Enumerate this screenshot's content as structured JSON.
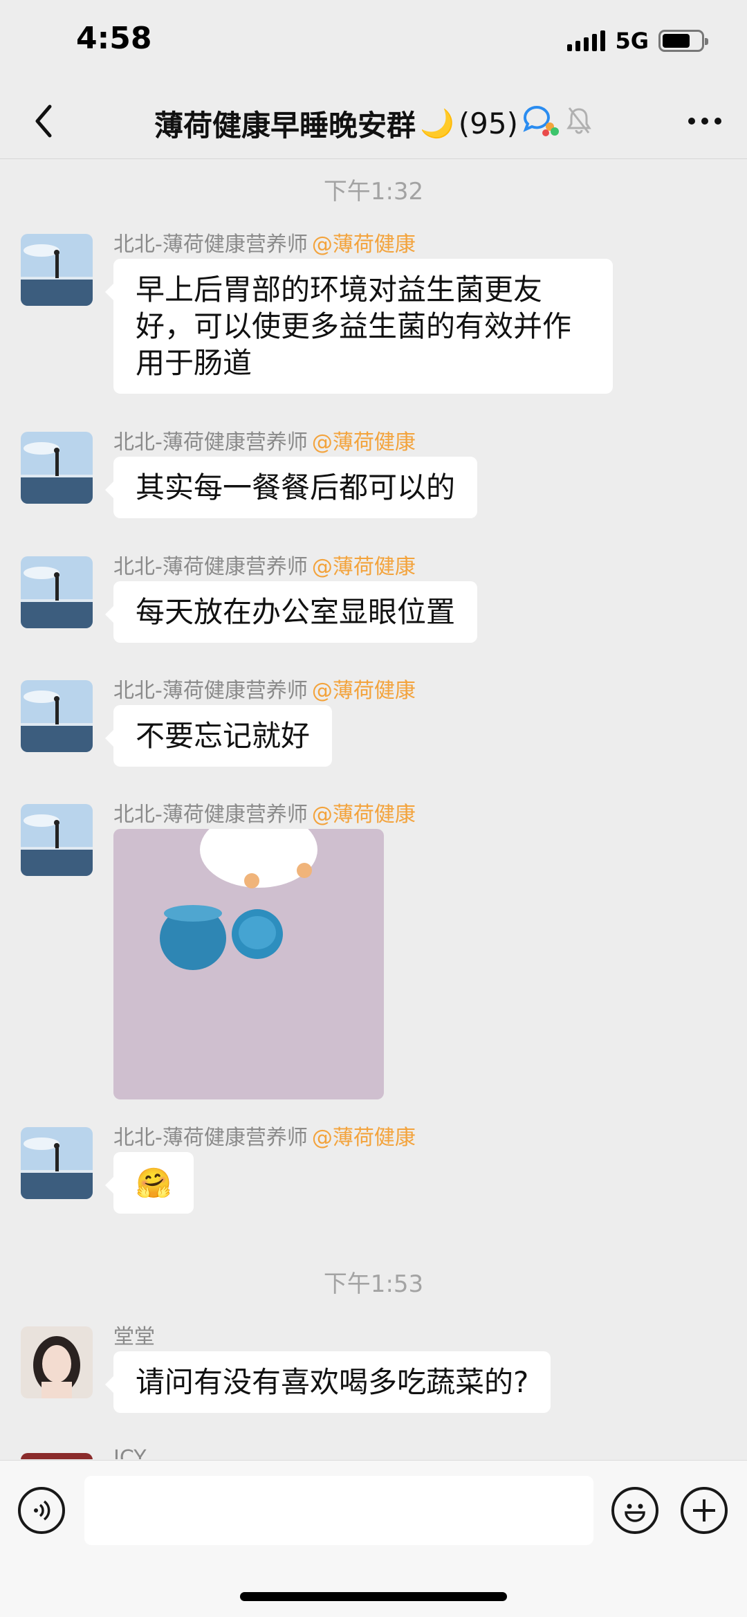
{
  "status": {
    "time": "4:58",
    "network": "5G",
    "battery_level": 0.72
  },
  "header": {
    "title": "薄荷健康早睡晚安群",
    "moon": "🌙",
    "member_count": "(95)",
    "icons": [
      "back-arrow-icon",
      "group-chat-icon",
      "mute-bell-icon",
      "more-icon"
    ]
  },
  "chat": {
    "time_labels": [
      "下午1:32",
      "下午1:53"
    ],
    "sender_name": "北北-薄荷健康营养师",
    "sender_org": "@薄荷健康",
    "messages": [
      {
        "text": "早上后胃部的环境对益生菌更友好，可以使更多益生菌的有效并作用于肠道"
      },
      {
        "text": "其实每一餐餐后都可以的"
      },
      {
        "text": "每天放在办公室显眼位置"
      },
      {
        "text": "不要忘记就好"
      },
      {
        "image": "photo of two blue BNRI capsule containers on a pink table"
      },
      {
        "text": "🤗"
      }
    ],
    "second_sender": "堂堂",
    "second_message": "请问有没有喜欢喝多吃蔬菜的?",
    "partial_sender": "ICY"
  },
  "input_bar": {
    "value": "",
    "icons": [
      "voice-icon",
      "emoji-icon",
      "plus-icon"
    ]
  },
  "colors": {
    "background": "#ededed",
    "bubble": "#ffffff",
    "org_tag": "#f3a33c",
    "meta_text": "#8a8a8a"
  }
}
